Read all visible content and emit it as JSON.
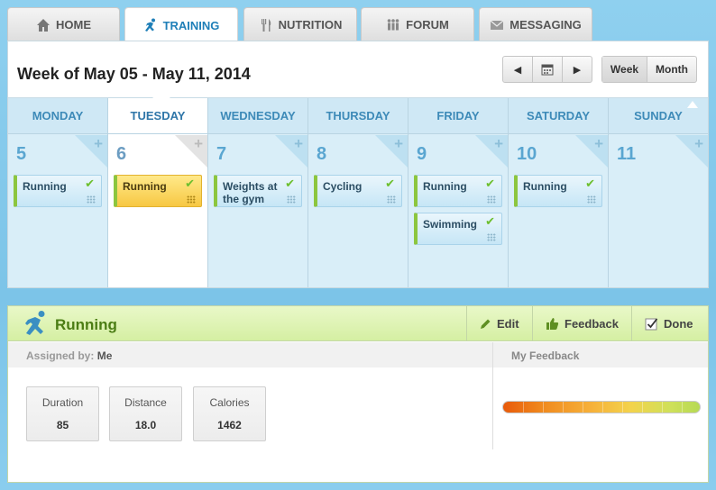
{
  "tabs": [
    {
      "label": "HOME",
      "icon": "home-icon"
    },
    {
      "label": "TRAINING",
      "icon": "runner-icon"
    },
    {
      "label": "NUTRITION",
      "icon": "fork-knife-icon"
    },
    {
      "label": "FORUM",
      "icon": "people-icon"
    },
    {
      "label": "MESSAGING",
      "icon": "envelope-icon"
    }
  ],
  "calendar": {
    "week_title": "Week of May 05 - May 11, 2014",
    "view_week": "Week",
    "view_month": "Month",
    "days": [
      {
        "name": "MONDAY",
        "num": "5",
        "events": [
          "Running"
        ]
      },
      {
        "name": "TUESDAY",
        "num": "6",
        "events": [
          "Running"
        ]
      },
      {
        "name": "WEDNESDAY",
        "num": "7",
        "events": [
          "Weights at the gym"
        ]
      },
      {
        "name": "THURSDAY",
        "num": "8",
        "events": [
          "Cycling"
        ]
      },
      {
        "name": "FRIDAY",
        "num": "9",
        "events": [
          "Running",
          "Swimming"
        ]
      },
      {
        "name": "SATURDAY",
        "num": "10",
        "events": [
          "Running"
        ]
      },
      {
        "name": "SUNDAY",
        "num": "11",
        "events": []
      }
    ]
  },
  "detail": {
    "title": "Running",
    "edit_label": "Edit",
    "feedback_label": "Feedback",
    "done_label": "Done",
    "assigned_prefix": "Assigned by:",
    "assigned_by": "Me",
    "my_feedback_label": "My Feedback",
    "stats": [
      {
        "label": "Duration",
        "value": "85"
      },
      {
        "label": "Distance",
        "value": "18.0"
      },
      {
        "label": "Calories",
        "value": "1462"
      }
    ],
    "feedback_level": 1.0
  },
  "colors": {
    "accent_blue": "#1f7fb8",
    "success_green": "#8cc63f",
    "highlight_yellow": "#f7c843"
  }
}
